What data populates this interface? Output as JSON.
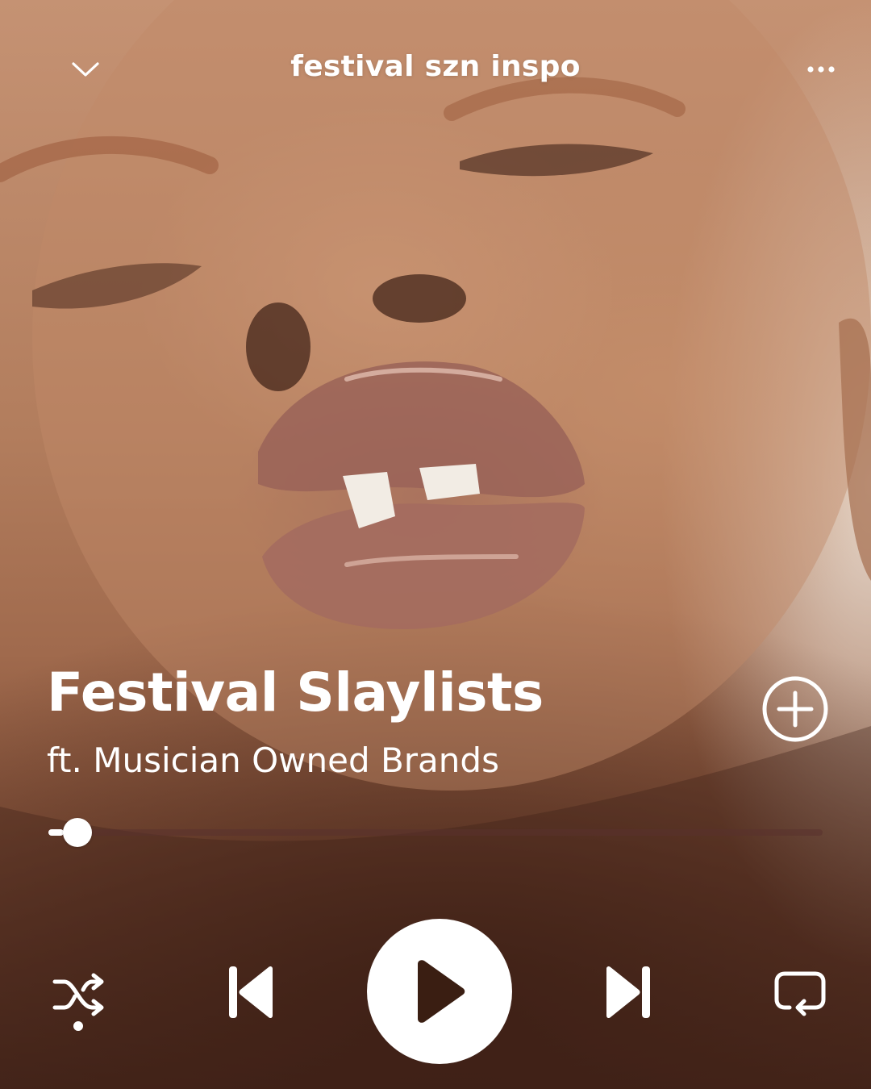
{
  "header": {
    "playlist_title": "festival szn inspo",
    "collapse_icon": "chevron-down-icon",
    "more_icon": "more-horizontal-icon"
  },
  "track": {
    "title": "Festival Slaylists",
    "subtitle": "ft. Musician Owned Brands",
    "add_icon": "add-circle-icon"
  },
  "playback": {
    "progress_fraction": 0.02,
    "shuffle_active": true,
    "controls": [
      "shuffle-icon",
      "previous-icon",
      "play-icon",
      "next-icon",
      "repeat-icon"
    ]
  },
  "colors": {
    "text": "#ffffff",
    "play_button_bg": "#ffffff",
    "play_glyph": "#3a1e12",
    "progress_track": "#6e3c34"
  }
}
